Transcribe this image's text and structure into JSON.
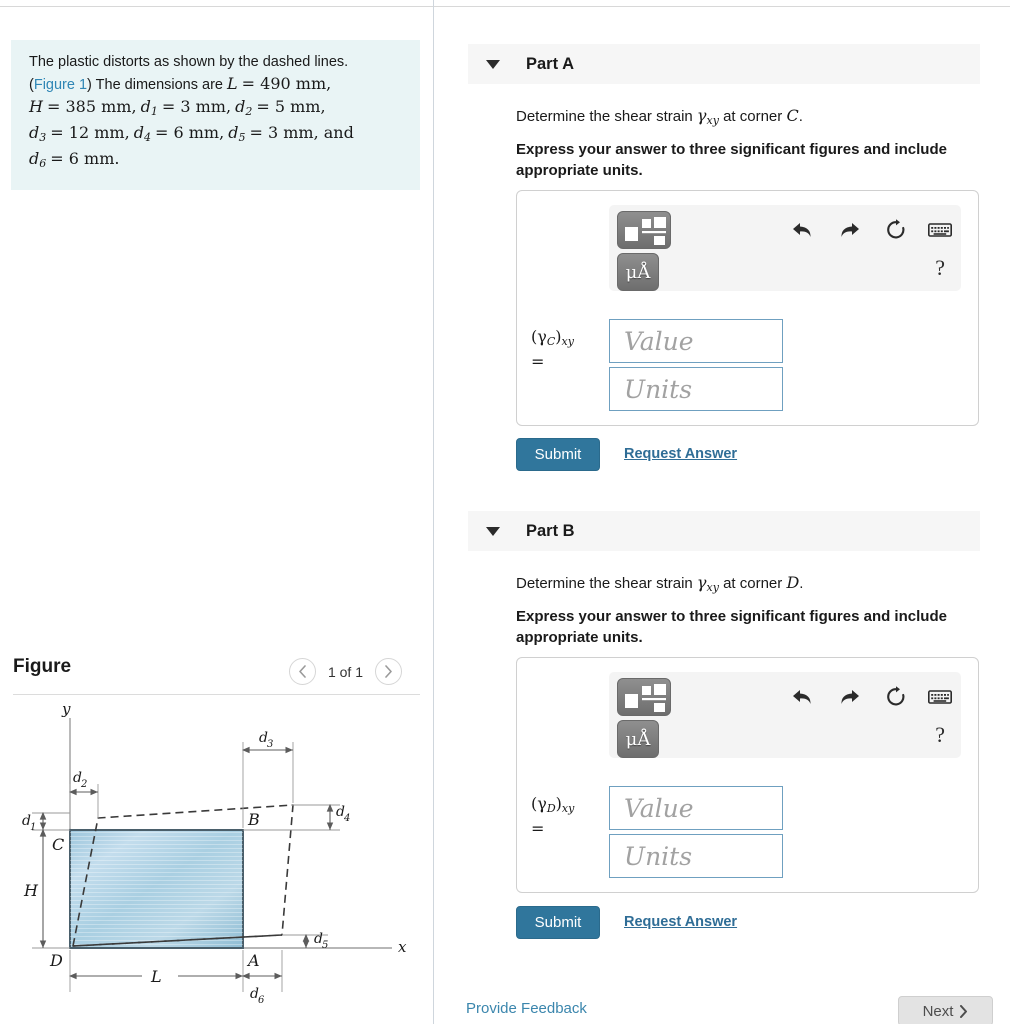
{
  "problem": {
    "line1": "The plastic distorts as shown by the dashed lines.",
    "figure_link": "Figure 1",
    "line2_pre": "(",
    "line2_post": ") The dimensions are ",
    "dims": [
      {
        "sym": "L",
        "sub": "",
        "val": "= 490 mm,"
      },
      {
        "sym": "H",
        "sub": "",
        "val": "= 385 mm,"
      },
      {
        "sym": "d",
        "sub": "1",
        "val": "= 3 mm,"
      },
      {
        "sym": "d",
        "sub": "2",
        "val": "= 5 mm,"
      },
      {
        "sym": "d",
        "sub": "3",
        "val": "= 12 mm,"
      },
      {
        "sym": "d",
        "sub": "4",
        "val": "= 6 mm,"
      },
      {
        "sym": "d",
        "sub": "5",
        "val": "= 3 mm, and"
      },
      {
        "sym": "d",
        "sub": "6",
        "val": "= 6 mm."
      }
    ]
  },
  "figure": {
    "title": "Figure",
    "pager_text": "1 of 1",
    "prev_icon": "chevron-left-icon",
    "next_icon": "chevron-right-icon",
    "labels": {
      "y_axis": "y",
      "x_axis": "x",
      "corner_a": "A",
      "corner_b": "B",
      "corner_c": "C",
      "corner_d": "D",
      "height": "H",
      "length": "L",
      "d1": "d",
      "d1sub": "1",
      "d2": "d",
      "d2sub": "2",
      "d3": "d",
      "d3sub": "3",
      "d4": "d",
      "d4sub": "4",
      "d5": "d",
      "d5sub": "5",
      "d6": "d",
      "d6sub": "6"
    },
    "colors": {
      "plate_fill_light": "#cfe4ef",
      "plate_fill_mid": "#a9cfe2",
      "plate_stroke": "#4a5f6b",
      "dash_stroke": "#3a3a3a",
      "dim_stroke": "#8c8c8c"
    }
  },
  "parts": [
    {
      "id": "part-a",
      "header": "Part A",
      "caret_icon": "caret-down-icon",
      "prompt_pre": "Determine the shear strain ",
      "prompt_sym": "γ",
      "prompt_sub": "xy",
      "prompt_mid": " at corner ",
      "prompt_corner": "C",
      "prompt_end": ".",
      "instruction": "Express your answer to three significant figures and include appropriate units.",
      "symbol_main": "(γ",
      "symbol_sub": "C",
      "symbol_close": ")",
      "symbol_xy": "xy",
      "symbol_eq": "=",
      "value_placeholder": "Value",
      "units_placeholder": "Units",
      "submit_label": "Submit",
      "request_label": "Request Answer"
    },
    {
      "id": "part-b",
      "header": "Part B",
      "caret_icon": "caret-down-icon",
      "prompt_pre": "Determine the shear strain ",
      "prompt_sym": "γ",
      "prompt_sub": "xy",
      "prompt_mid": " at corner ",
      "prompt_corner": "D",
      "prompt_end": ".",
      "instruction": "Express your answer to three significant figures and include appropriate units.",
      "symbol_main": "(γ",
      "symbol_sub": "D",
      "symbol_close": ")",
      "symbol_xy": "xy",
      "symbol_eq": "=",
      "value_placeholder": "Value",
      "units_placeholder": "Units",
      "submit_label": "Submit",
      "request_label": "Request Answer"
    }
  ],
  "toolbar": {
    "template_icon": "math-template-icon",
    "units_label": "μÅ",
    "units_icon": "units-icon",
    "undo_icon": "undo-arrow-icon",
    "redo_icon": "redo-arrow-icon",
    "reset_icon": "reset-circular-arrow-icon",
    "keyboard_icon": "keyboard-icon",
    "help_label": "?"
  },
  "footer": {
    "feedback_label": "Provide Feedback",
    "next_label": "Next",
    "next_icon": "chevron-right-icon"
  },
  "colors": {
    "accent_blue": "#30769c",
    "link_blue": "#3b86ad",
    "info_bg": "#e9f4f5",
    "header_bg": "#f6f6f6"
  }
}
